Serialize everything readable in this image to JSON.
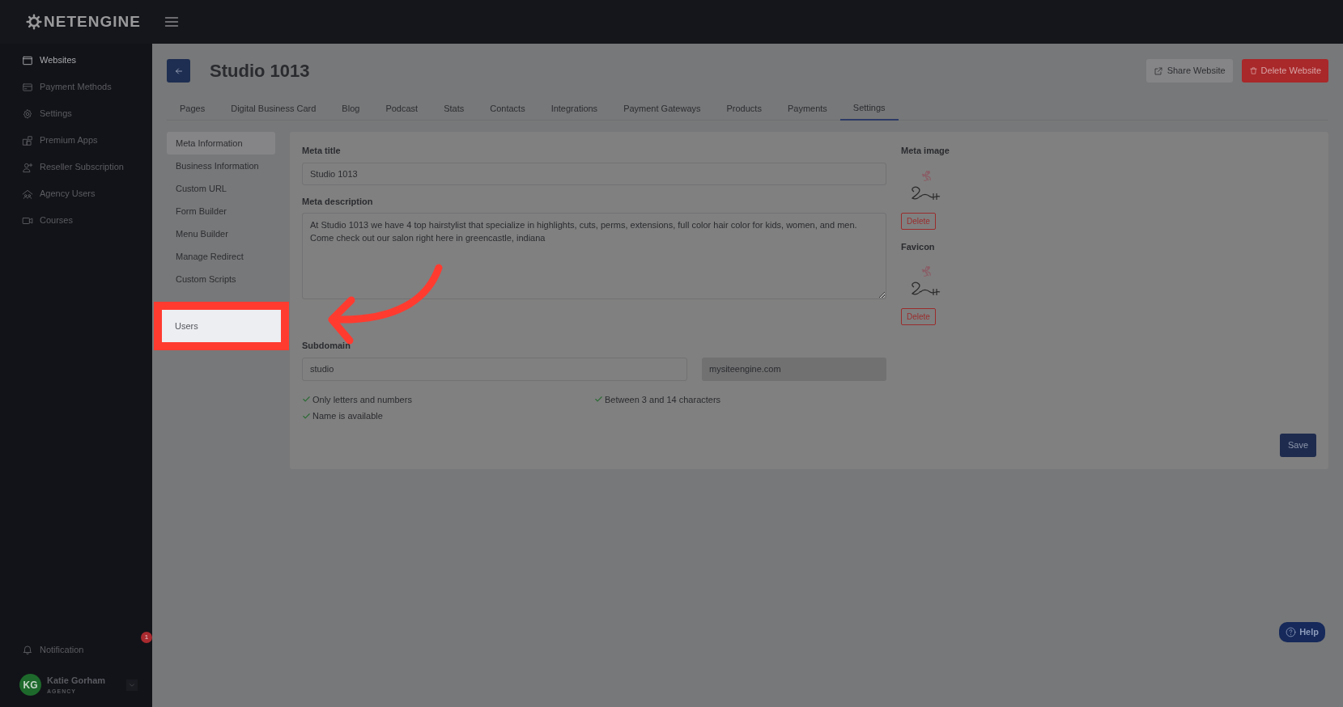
{
  "brand": {
    "name": "NETENGINE"
  },
  "sidebar": {
    "items": [
      {
        "label": "Websites",
        "selected": true
      },
      {
        "label": "Payment Methods",
        "selected": false
      },
      {
        "label": "Settings",
        "selected": false
      },
      {
        "label": "Premium Apps",
        "selected": false
      },
      {
        "label": "Reseller Subscription",
        "selected": false
      },
      {
        "label": "Agency Users",
        "selected": false
      },
      {
        "label": "Courses",
        "selected": false
      }
    ],
    "notification": {
      "label": "Notification",
      "badge": "1"
    },
    "user": {
      "initials": "KG",
      "name": "Katie Gorham",
      "role": "AGENCY"
    }
  },
  "header": {
    "title": "Studio 1013",
    "share_button": "Share Website",
    "delete_button": "Delete Website"
  },
  "tabs": [
    {
      "label": "Pages",
      "selected": false
    },
    {
      "label": "Digital Business Card",
      "selected": false
    },
    {
      "label": "Blog",
      "selected": false
    },
    {
      "label": "Podcast",
      "selected": false
    },
    {
      "label": "Stats",
      "selected": false
    },
    {
      "label": "Contacts",
      "selected": false
    },
    {
      "label": "Integrations",
      "selected": false
    },
    {
      "label": "Payment Gateways",
      "selected": false
    },
    {
      "label": "Products",
      "selected": false
    },
    {
      "label": "Payments",
      "selected": false
    },
    {
      "label": "Settings",
      "selected": true
    }
  ],
  "settings_menu": [
    {
      "label": "Meta Information",
      "selected": true
    },
    {
      "label": "Business Information",
      "selected": false
    },
    {
      "label": "Custom URL",
      "selected": false
    },
    {
      "label": "Form Builder",
      "selected": false
    },
    {
      "label": "Menu Builder",
      "selected": false
    },
    {
      "label": "Manage Redirect",
      "selected": false
    },
    {
      "label": "Custom Scripts",
      "selected": false
    }
  ],
  "highlight": {
    "label": "Users"
  },
  "form": {
    "meta_title": {
      "label": "Meta title",
      "value": "Studio 1013"
    },
    "meta_description": {
      "label": "Meta description",
      "value": "At Studio 1013 we have 4 top hairstylist that specialize in highlights, cuts, perms, extensions, full color hair color for kids, women, and men. Come check out our salon right here in greencastle, indiana"
    },
    "subdomain": {
      "label": "Subdomain",
      "value": "studio",
      "domain": "mysiteengine.com"
    },
    "checks": [
      {
        "label": "Only letters and numbers",
        "passed": true
      },
      {
        "label": "Between 3 and 14 characters",
        "passed": true
      },
      {
        "label": "Name is available",
        "passed": true
      }
    ],
    "meta_image": {
      "label": "Meta image",
      "delete_button": "Delete"
    },
    "favicon": {
      "label": "Favicon",
      "delete_button": "Delete"
    },
    "save_button": "Save"
  },
  "help_button": "Help"
}
